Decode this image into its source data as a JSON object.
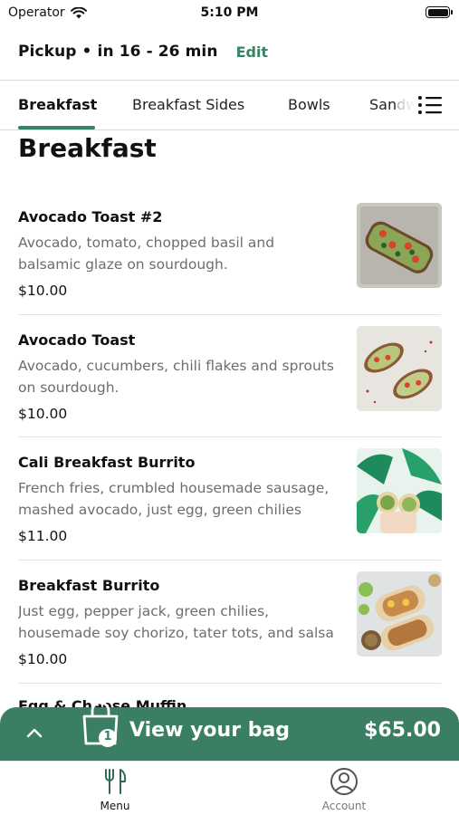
{
  "status_bar": {
    "carrier": "Operator",
    "time": "5:10 PM"
  },
  "pickup": {
    "text": "Pickup • in 16 - 26 min",
    "edit_label": "Edit"
  },
  "tabs": [
    {
      "label": "Breakfast",
      "active": true
    },
    {
      "label": "Breakfast Sides",
      "active": false
    },
    {
      "label": "Bowls",
      "active": false
    },
    {
      "label": "Sandwiches",
      "active": false
    }
  ],
  "section": {
    "title": "Breakfast"
  },
  "items": [
    {
      "name": "Avocado Toast #2",
      "description": "Avocado, tomato, chopped basil and balsamic glaze on sourdough.",
      "price": "$10.00"
    },
    {
      "name": "Avocado Toast",
      "description": "Avocado, cucumbers, chili flakes and sprouts on sourdough.",
      "price": "$10.00"
    },
    {
      "name": "Cali Breakfast Burrito",
      "description": " French fries, crumbled housemade sausage, mashed avocado, just egg, green chilies",
      "price": "$11.00"
    },
    {
      "name": "Breakfast Burrito",
      "description": "Just egg, pepper jack, green chilies, housemade soy chorizo, tater tots, and salsa",
      "price": "$10.00"
    }
  ],
  "next_item_peek": "Egg & Cheese Muffin",
  "bag": {
    "label": "View your bag",
    "count": "1",
    "total": "$65.00"
  },
  "bottom_nav": {
    "menu_label": "Menu",
    "account_label": "Account"
  },
  "colors": {
    "accent": "#3a8466",
    "bag_bar": "#3a7f63"
  }
}
